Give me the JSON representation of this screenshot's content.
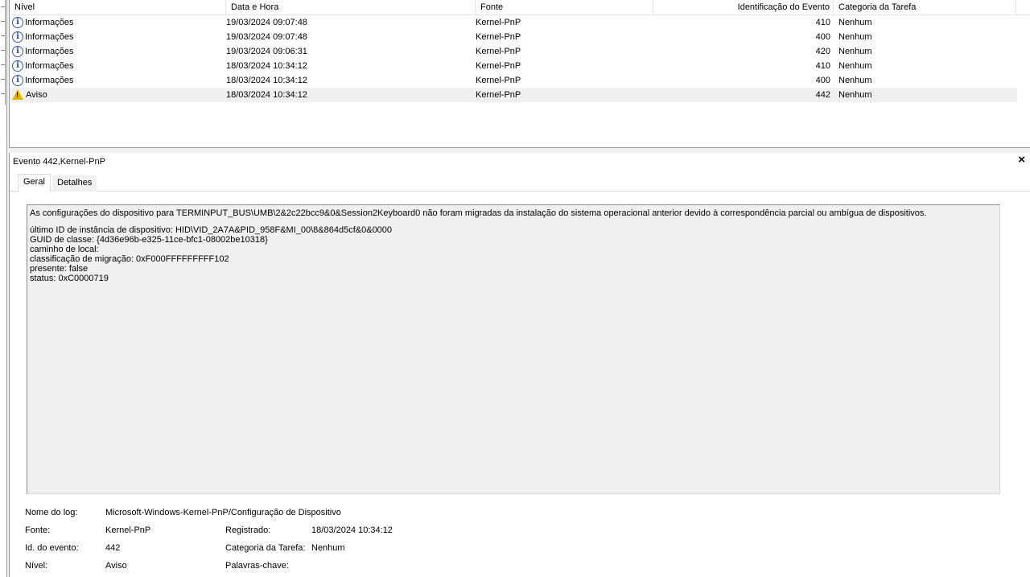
{
  "list": {
    "columns": {
      "level": "Nível",
      "date": "Data e Hora",
      "source": "Fonte",
      "event_id": "Identificação do Evento",
      "task_category": "Categoria da Tarefa"
    },
    "rows": [
      {
        "level": "Informações",
        "icon": "info-icon",
        "date": "19/03/2024 09:07:48",
        "source": "Kernel-PnP",
        "event_id": "410",
        "task_category": "Nenhum"
      },
      {
        "level": "Informações",
        "icon": "info-icon",
        "date": "19/03/2024 09:07:48",
        "source": "Kernel-PnP",
        "event_id": "400",
        "task_category": "Nenhum"
      },
      {
        "level": "Informações",
        "icon": "info-icon",
        "date": "19/03/2024 09:06:31",
        "source": "Kernel-PnP",
        "event_id": "420",
        "task_category": "Nenhum"
      },
      {
        "level": "Informações",
        "icon": "info-icon",
        "date": "18/03/2024 10:34:12",
        "source": "Kernel-PnP",
        "event_id": "410",
        "task_category": "Nenhum"
      },
      {
        "level": "Informações",
        "icon": "info-icon",
        "date": "18/03/2024 10:34:12",
        "source": "Kernel-PnP",
        "event_id": "400",
        "task_category": "Nenhum"
      },
      {
        "level": "Aviso",
        "icon": "warning-icon",
        "date": "18/03/2024 10:34:12",
        "source": "Kernel-PnP",
        "event_id": "442",
        "task_category": "Nenhum"
      }
    ]
  },
  "detail": {
    "title": "Evento 442,Kernel-PnP",
    "close_label": "×",
    "tabs": {
      "general": "Geral",
      "details": "Detalhes"
    },
    "description": {
      "line1": "As configurações do dispositivo para TERMINPUT_BUS\\UMB\\2&2c22bcc9&0&Session2Keyboard0 não foram migradas da instalação do sistema operacional anterior devido à correspondência parcial ou ambígua de dispositivos.",
      "line2": "último ID de instância de dispositivo:  HID\\VID_2A7A&PID_958F&MI_00\\8&864d5cf&0&0000",
      "line3": "GUID de classe:  {4d36e96b-e325-11ce-bfc1-08002be10318}",
      "line4": "caminho de local:",
      "line5": "classificação de migração:  0xF000FFFFFFFFF102",
      "line6": "presente:  false",
      "line7": "status:  0xC0000719"
    },
    "properties": {
      "log_name_label": "Nome do log:",
      "log_name_value": "Microsoft-Windows-Kernel-PnP/Configuração de Dispositivo",
      "source_label": "Fonte:",
      "source_value": "Kernel-PnP",
      "logged_label": "Registrado:",
      "logged_value": "18/03/2024 10:34:12",
      "event_id_label": "Id. do evento:",
      "event_id_value": "442",
      "task_category_label": "Categoria da Tarefa:",
      "task_category_value": "Nenhum",
      "level_label": "Nível:",
      "level_value": "Aviso",
      "keywords_label": "Palavras-chave:",
      "keywords_value": ""
    }
  }
}
